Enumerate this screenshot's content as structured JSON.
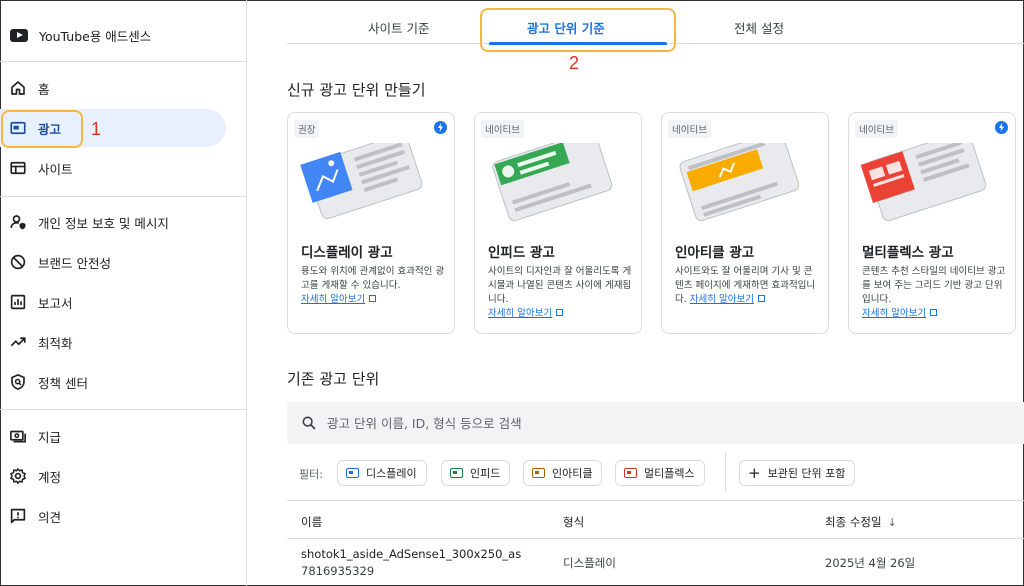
{
  "sidebar": {
    "brand": "YouTube용 애드센스",
    "items": [
      {
        "label": "홈",
        "icon": "home-icon"
      },
      {
        "label": "광고",
        "icon": "ads-icon"
      },
      {
        "label": "사이트",
        "icon": "sites-icon"
      },
      {
        "label": "개인 정보 보호 및 메시지",
        "icon": "privacy-icon"
      },
      {
        "label": "브랜드 안전성",
        "icon": "block-icon"
      },
      {
        "label": "보고서",
        "icon": "reports-icon"
      },
      {
        "label": "최적화",
        "icon": "trending-icon"
      },
      {
        "label": "정책 센터",
        "icon": "policy-shield-icon"
      },
      {
        "label": "지급",
        "icon": "payments-icon"
      },
      {
        "label": "계정",
        "icon": "gear-icon"
      },
      {
        "label": "의견",
        "icon": "feedback-icon"
      }
    ]
  },
  "annotations": {
    "one": "1",
    "two": "2"
  },
  "tabs": [
    {
      "label": "사이트 기준"
    },
    {
      "label": "광고 단위 기준"
    },
    {
      "label": "전체 설정"
    }
  ],
  "new_section_title": "신규 광고 단위 만들기",
  "cards": [
    {
      "badge": "권장",
      "title": "디스플레이 광고",
      "desc": "용도와 위치에 관계없이 효과적인 광고를 게재할 수 있습니다.",
      "link": "자세히 알아보기",
      "color": "#4285f4"
    },
    {
      "badge": "네이티브",
      "title": "인피드 광고",
      "desc": "사이트의 디자인과 잘 어울리도록 게시물과 나열된 콘텐츠 사이에 게재됩니다.",
      "link": "자세히 알아보기",
      "color": "#34a853"
    },
    {
      "badge": "네이티브",
      "title": "인아티클 광고",
      "desc": "사이트와도 잘 어울리며 기사 및 콘텐츠 페이지에 게재하면 효과적입니다.",
      "link": "자세히 알아보기",
      "color": "#f9ab00"
    },
    {
      "badge": "네이티브",
      "title": "멀티플렉스 광고",
      "desc": "콘텐츠 추천 스타일의 네이티브 광고를 보여 주는 그리드 기반 광고 단위입니다.",
      "link": "자세히 알아보기",
      "color": "#ea4335"
    }
  ],
  "existing_section_title": "기존 광고 단위",
  "search": {
    "placeholder": "광고 단위 이름, ID, 형식 등으로 검색"
  },
  "filters": {
    "label": "필터:",
    "chips": [
      {
        "label": "디스플레이",
        "color": "#1a73e8"
      },
      {
        "label": "인피드",
        "color": "#188038"
      },
      {
        "label": "인아티클",
        "color": "#b06000"
      },
      {
        "label": "멀티플렉스",
        "color": "#d93025"
      }
    ],
    "archived": "보관된 단위 포함"
  },
  "table": {
    "headers": {
      "name": "이름",
      "type": "형식",
      "modified": "최종 수정일"
    },
    "rows": [
      {
        "name": "shotok1_aside_AdSense1_300x250_as",
        "id": "7816935329",
        "type": "디스플레이",
        "modified": "2025년 4월 26일"
      }
    ]
  }
}
